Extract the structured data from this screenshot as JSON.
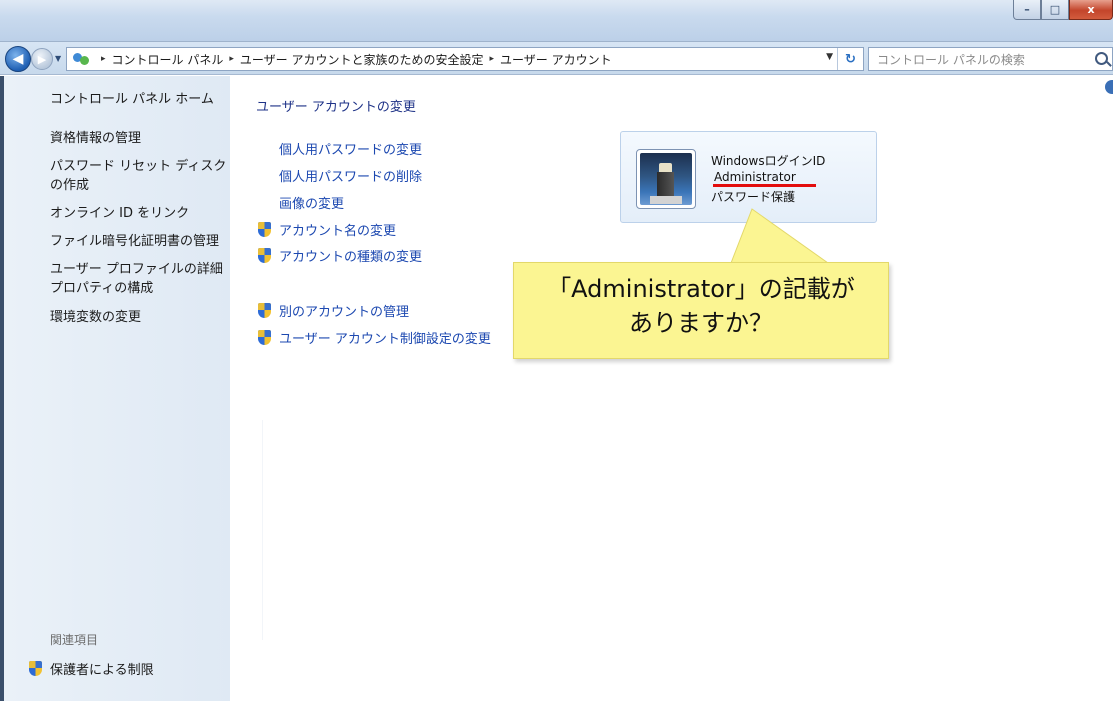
{
  "window": {
    "minimize_label": "–",
    "maximize_label": "□",
    "close_label": "x"
  },
  "nav": {
    "back_label": "◀",
    "forward_label": "▶",
    "history_label": "▼",
    "breadcrumbs": [
      "コントロール パネル",
      "ユーザー アカウントと家族のための安全設定",
      "ユーザー アカウント"
    ],
    "crumb_separator": "▸",
    "address_dropdown_label": "▼",
    "refresh_label": "↻",
    "search_placeholder": "コントロール パネルの検索"
  },
  "sidebar": {
    "home_label": "コントロール パネル ホーム",
    "items": [
      "資格情報の管理",
      "パスワード リセット ディスクの作成",
      "オンライン ID をリンク",
      "ファイル暗号化証明書の管理",
      "ユーザー プロファイルの詳細プロパティの構成",
      "環境変数の変更"
    ],
    "related_label": "関連項目",
    "related_link": "保護者による制限"
  },
  "main": {
    "title": "ユーザー アカウントの変更",
    "tasks": [
      "個人用パスワードの変更",
      "個人用パスワードの削除",
      "画像の変更",
      "アカウント名の変更",
      "アカウントの種類の変更"
    ],
    "other_tasks": [
      "別のアカウントの管理",
      "ユーザー アカウント制御設定の変更"
    ]
  },
  "user_tile": {
    "line1": "WindowsログインID",
    "line2": "Administrator",
    "line3": "パスワード保護"
  },
  "callout": {
    "line1": "「Administrator」の記載が",
    "line2": "ありますか？"
  },
  "colors": {
    "link": "#1c48b0",
    "title": "#1e3287",
    "callout_bg": "#fbf592",
    "underline": "#e30d0d"
  }
}
